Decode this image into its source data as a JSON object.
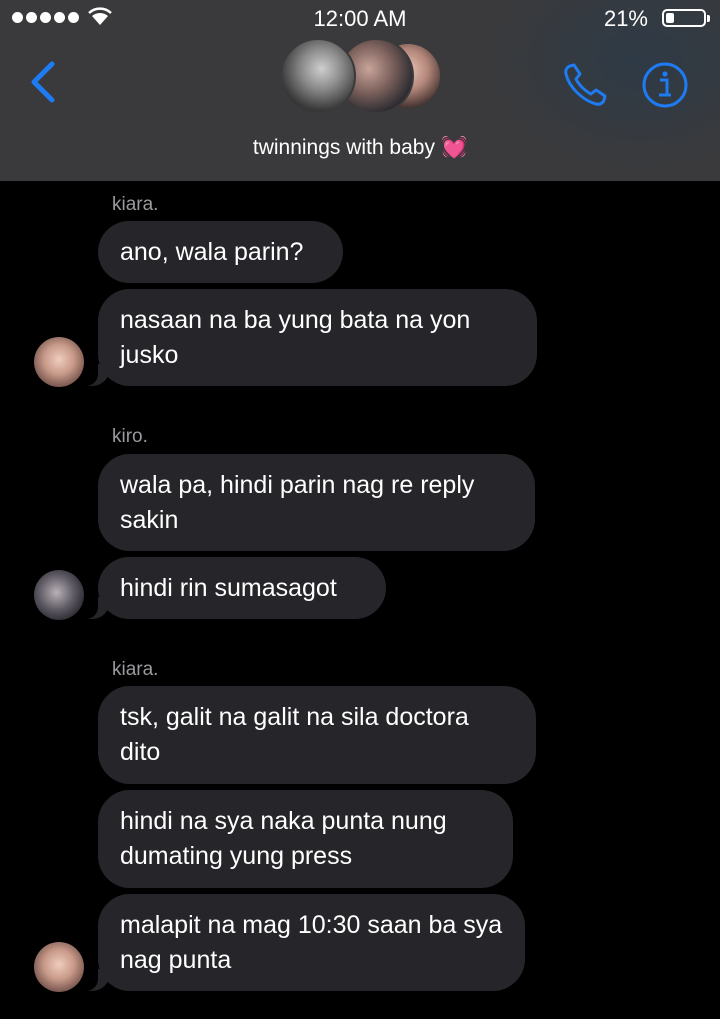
{
  "status": {
    "time": "12:00 AM",
    "battery": "21%",
    "battery_level": 0.21
  },
  "header": {
    "title": "twinnings with baby",
    "title_emoji": "💓",
    "icons": [
      "chevron-left-icon",
      "phone-icon",
      "info-icon"
    ],
    "accent": "#1e7bf2"
  },
  "messages": [
    {
      "sender": "kiara.",
      "bubbles": [
        "ano, wala parin?",
        "nasaan na ba yung bata na yon jusko"
      ]
    },
    {
      "sender": "kiro.",
      "bubbles": [
        "wala pa, hindi parin nag re reply sakin",
        "hindi rin sumasagot"
      ]
    },
    {
      "sender": "kiara.",
      "bubbles": [
        "tsk, galit na galit na sila doctora dito",
        "hindi na sya naka punta nung dumating yung press",
        "malapit na mag 10:30 saan ba sya nag punta"
      ]
    }
  ]
}
